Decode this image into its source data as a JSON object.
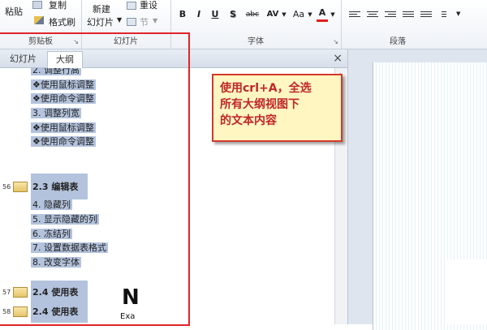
{
  "ribbon": {
    "clipboard": {
      "paste_label": "粘贴",
      "copy_label": "复制",
      "format_painter_label": "格式刷",
      "group_label": "剪贴板"
    },
    "slides": {
      "new_slide_line1": "新建",
      "new_slide_line2": "幻灯片",
      "reset_label": "重设",
      "section_label": "节",
      "group_label": "幻灯片"
    },
    "font": {
      "bold": "B",
      "italic": "I",
      "underline": "U",
      "shadow": "S",
      "strike": "abc",
      "spacing": "AV",
      "case": "Aa",
      "color": "A",
      "group_label": "字体"
    },
    "paragraph": {
      "group_label": "段落"
    }
  },
  "pane": {
    "tabs": [
      {
        "label": "幻灯片"
      },
      {
        "label": "大纲"
      }
    ],
    "close_glyph": "×"
  },
  "outline": {
    "items": [
      {
        "text": "2. 调整行高"
      },
      {
        "text": "❖使用鼠标调整"
      },
      {
        "text": "❖使用命令调整"
      },
      {
        "text": "3. 调整列宽"
      },
      {
        "text": "❖使用鼠标调整"
      },
      {
        "text": "❖使用命令调整"
      },
      {
        "slide_num": "56",
        "text": "2.3 编辑表"
      },
      {
        "text": "4. 隐藏列"
      },
      {
        "text": "5. 显示隐藏的列"
      },
      {
        "text": "6. 冻结列"
      },
      {
        "text": "7. 设置数据表格式"
      },
      {
        "text": "8. 改变字体"
      },
      {
        "slide_num": "57",
        "text": "2.4 使用表"
      },
      {
        "slide_num": "58",
        "text": "2.4 使用表"
      }
    ]
  },
  "callout": {
    "line1": "使用crl+A，全选",
    "line2": "所有大纲视图下",
    "line3": "的文本内容"
  },
  "slide_preview": {
    "logo_letter": "N",
    "logo_text": "Exa"
  },
  "colors": {
    "selection": "#b3c3dd",
    "callout_border": "#d23a2a",
    "callout_text": "#c0262a",
    "callout_bg": "#fff6c2",
    "red_box": "#e0242a"
  }
}
